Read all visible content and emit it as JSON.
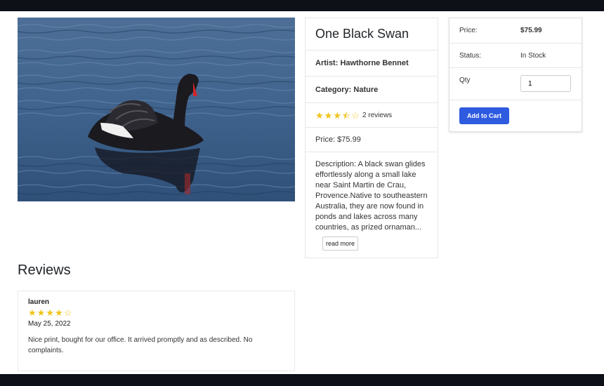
{
  "product": {
    "title": "One Black Swan",
    "artist_label": "Artist: Hawthorne Bennet",
    "category_label": "Category: Nature",
    "rating": 3.5,
    "reviews_count_label": "2 reviews",
    "price_label": "Price: $75.99",
    "description": "Description: A black swan glides effortlessly along a small lake near Saint Martin de Crau, Provence.Native to southeastern Australia, they are now found in ponds and lakes across many countries, as prized ornaman...",
    "read_more_label": "read more",
    "star_color": "#f0c419"
  },
  "cart": {
    "price_label": "Price:",
    "price_value": "$75.99",
    "status_label": "Status:",
    "status_value": "In Stock",
    "qty_label": "Qty",
    "qty_value": "1",
    "add_to_cart_label": "Add to Cart",
    "button_color": "#2f5be0"
  },
  "reviews": {
    "heading": "Reviews",
    "items": [
      {
        "name": "lauren",
        "rating": 4,
        "date": "May 25, 2022",
        "text": "Nice print, bought for our office. It arrived promptly and as described. No complaints."
      }
    ]
  }
}
